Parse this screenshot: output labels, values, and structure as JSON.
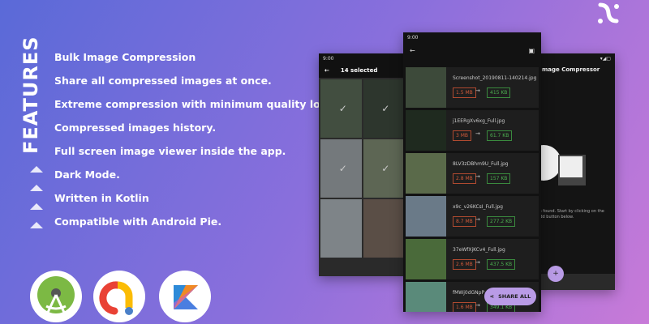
{
  "features_title": "FEATURES",
  "features": [
    "Bulk Image Compression",
    "Share all compressed images at once.",
    "Extreme compression with minimum quality loss.",
    "Compressed images history.",
    "Full screen image viewer inside the app.",
    "Dark Mode.",
    "Written in Kotlin",
    "Compatible with Android Pie."
  ],
  "tools": [
    "android-studio-icon",
    "google-admob-icon",
    "kotlin-icon"
  ],
  "left_phone": {
    "time": "9:00",
    "title": "14 selected"
  },
  "middle_phone": {
    "time": "9:00",
    "share_label": "SHARE ALL",
    "items": [
      {
        "name": "Screenshot_20190811-140214.jpg",
        "from": "1.5 MB",
        "to": "415 KB"
      },
      {
        "name": "j1EERgXv6xg_Full.jpg",
        "from": "3 MB",
        "to": "61.7 KB"
      },
      {
        "name": "8LV3zDBhm9U_Full.jpg",
        "from": "2.8 MB",
        "to": "157 KB"
      },
      {
        "name": "x9c_v26KCsI_Full.jpg",
        "from": "8.7 MB",
        "to": "277.2 KB"
      },
      {
        "name": "37eWfXjKCv4_Full.jpg",
        "from": "2.6 MB",
        "to": "437.5 KB"
      },
      {
        "name": "fMWj0dGNpP",
        "from": "1.6 MB",
        "to": "349.1 KB"
      }
    ]
  },
  "right_phone": {
    "title": "mage Compressor",
    "empty_text": "es found. Start by clicking on the Add button below.",
    "fab": "+"
  },
  "colors": {
    "accent": "#b99be6",
    "old_size": "#d05a3a",
    "new_size": "#4caf50"
  }
}
